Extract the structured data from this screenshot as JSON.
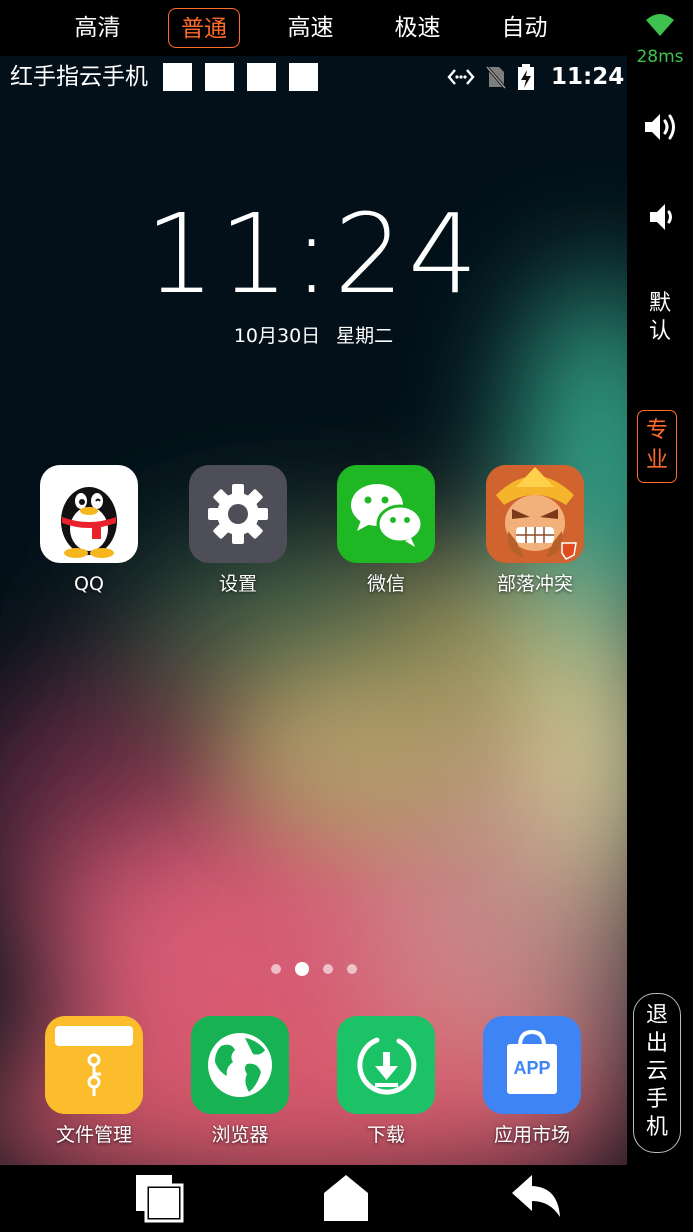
{
  "quality_bar": {
    "items": [
      "高清",
      "普通",
      "高速",
      "极速",
      "自动"
    ],
    "active": "普通"
  },
  "right_panel": {
    "latency": "28ms",
    "mode_default": [
      "默",
      "认"
    ],
    "mode_pro": [
      "专",
      "业"
    ],
    "exit": [
      "退",
      "出",
      "云",
      "手",
      "机"
    ]
  },
  "status_bar": {
    "title": "红手指云手机",
    "time": "11:24",
    "icons": [
      "data-sync-icon",
      "no-sim-icon",
      "battery-charging-icon"
    ]
  },
  "lockclock": {
    "time": "11:24",
    "date": "10月30日",
    "weekday": "星期二"
  },
  "home_apps": [
    {
      "label": "QQ",
      "icon": "qq-penguin-icon"
    },
    {
      "label": "设置",
      "icon": "gear-icon"
    },
    {
      "label": "微信",
      "icon": "wechat-icon"
    },
    {
      "label": "部落冲突",
      "icon": "clash-of-clans-icon"
    }
  ],
  "dock_apps": [
    {
      "label": "文件管理",
      "icon": "file-folder-icon"
    },
    {
      "label": "浏览器",
      "icon": "globe-icon"
    },
    {
      "label": "下载",
      "icon": "download-icon"
    },
    {
      "label": "应用市场",
      "icon": "app-store-icon",
      "badge": "APP"
    }
  ],
  "pages": {
    "count": 4,
    "current": 2
  },
  "colors": {
    "accent": "#ff6a2b",
    "latency": "#3ec24f",
    "wechat": "#1fb824",
    "browser": "#16b253",
    "download": "#1bc266",
    "market": "#3f84f5",
    "files": "#fbbd2c"
  }
}
